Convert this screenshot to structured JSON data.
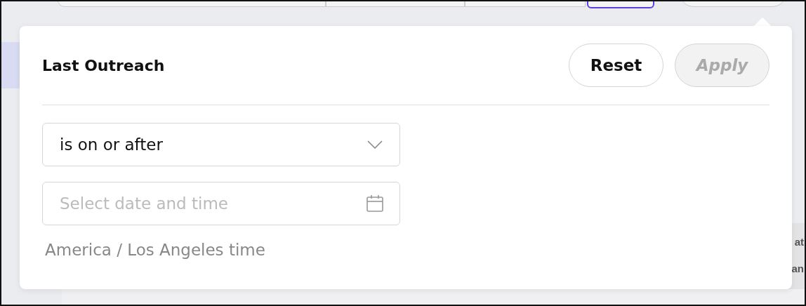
{
  "popover": {
    "title": "Last Outreach",
    "buttons": [
      {
        "label": "Reset",
        "disabled": false
      },
      {
        "label": "Apply",
        "disabled": true
      }
    ],
    "operator": {
      "value": "is on or after"
    },
    "datetime": {
      "placeholder": "Select date and time"
    },
    "timezone": "America / Los Angeles time"
  },
  "background_texts": [
    "at",
    "an"
  ]
}
